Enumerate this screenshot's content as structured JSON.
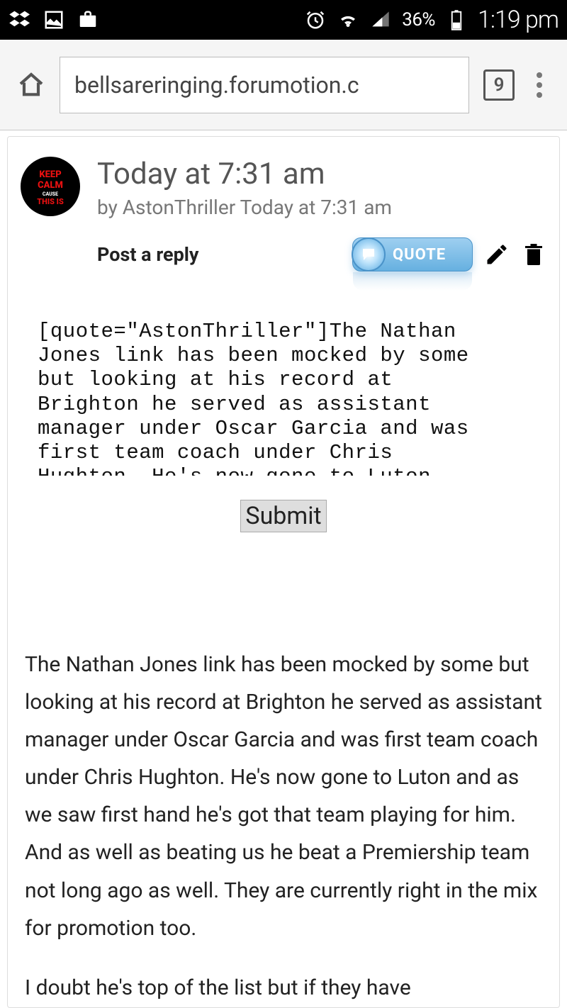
{
  "statusbar": {
    "battery_percent": "36%",
    "clock": "1:19 pm"
  },
  "browser": {
    "url": "bellsareringing.forumotion.c",
    "tab_count": "9"
  },
  "post": {
    "title": "Today at 7:31 am",
    "by_prefix": "by ",
    "author": "AstonThriller",
    "byline_time": " Today at 7:31 am",
    "reply_label": "Post a reply",
    "quote_label": "QUOTE",
    "avatar": {
      "line1": "KEEP",
      "line2": "CALM",
      "line3": "CAUSE",
      "line4": "THIS IS"
    }
  },
  "reply": {
    "textarea_value": "[quote=\"AstonThriller\"]The Nathan Jones link has been mocked by some but looking at his record at Brighton he served as assistant manager under Oscar Garcia and was first team coach under Chris Hughton. He's now gone to Luton",
    "submit_label": "Submit"
  },
  "content": {
    "body": "The Nathan Jones link has been mocked by some but looking at his record at Brighton he served as assistant manager under Oscar Garcia and was first team coach under Chris Hughton. He's now gone to Luton and as we saw first hand he's got that team playing for him. And as well as beating us he beat a Premiership team not long ago as well. They are currently right in the mix for promotion too.",
    "cutoff": "I doubt he's top of the list but if they have"
  }
}
